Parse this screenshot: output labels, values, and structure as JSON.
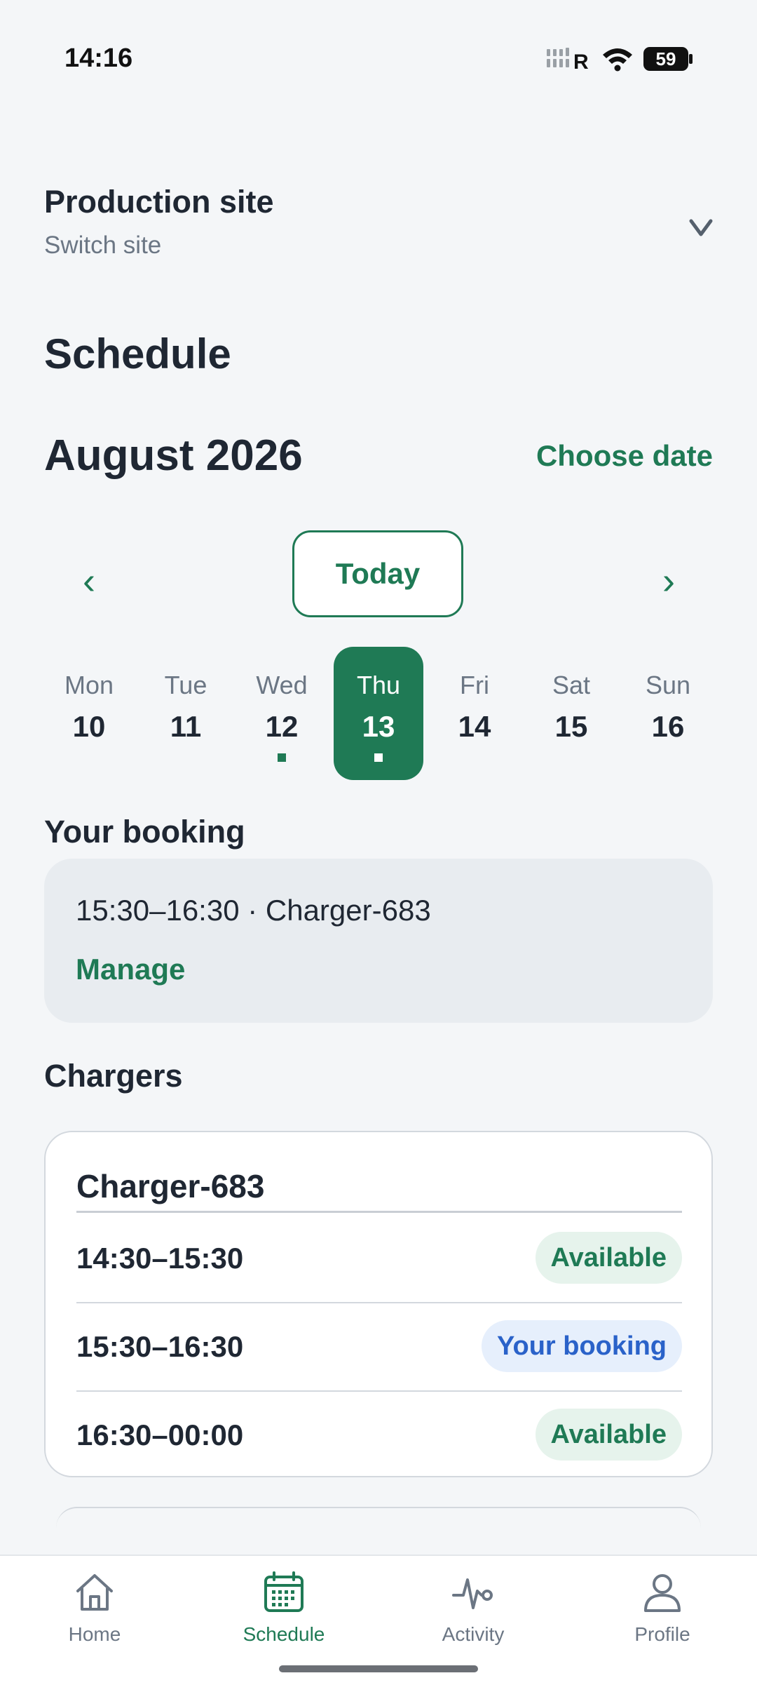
{
  "status_bar": {
    "time": "14:16",
    "battery": "59",
    "network_label": "R"
  },
  "site": {
    "name": "Production site",
    "subtitle": "Switch site"
  },
  "page_title": "Schedule",
  "calendar": {
    "month": "August 2026",
    "choose_date_label": "Choose date",
    "today_label": "Today",
    "prev_label": "‹",
    "next_label": "›",
    "days": [
      {
        "dow": "Mon",
        "dom": "10",
        "has_dot": false,
        "selected": false
      },
      {
        "dow": "Tue",
        "dom": "11",
        "has_dot": false,
        "selected": false
      },
      {
        "dow": "Wed",
        "dom": "12",
        "has_dot": true,
        "selected": false
      },
      {
        "dow": "Thu",
        "dom": "13",
        "has_dot": true,
        "selected": true
      },
      {
        "dow": "Fri",
        "dom": "14",
        "has_dot": false,
        "selected": false
      },
      {
        "dow": "Sat",
        "dom": "15",
        "has_dot": false,
        "selected": false
      },
      {
        "dow": "Sun",
        "dom": "16",
        "has_dot": false,
        "selected": false
      }
    ]
  },
  "your_booking": {
    "heading": "Your booking",
    "details": "15:30–16:30 · Charger-683",
    "manage_label": "Manage"
  },
  "chargers": {
    "heading": "Chargers",
    "items": [
      {
        "name": "Charger-683",
        "slots": [
          {
            "time": "14:30–15:30",
            "status": "Available",
            "kind": "available"
          },
          {
            "time": "15:30–16:30",
            "status": "Your booking",
            "kind": "booking"
          },
          {
            "time": "16:30–00:00",
            "status": "Available",
            "kind": "available"
          }
        ]
      }
    ]
  },
  "bottom_nav": {
    "items": [
      {
        "label": "Home",
        "icon": "home-icon",
        "active": false
      },
      {
        "label": "Schedule",
        "icon": "calendar-icon",
        "active": true
      },
      {
        "label": "Activity",
        "icon": "activity-icon",
        "active": false
      },
      {
        "label": "Profile",
        "icon": "profile-icon",
        "active": false
      }
    ]
  },
  "colors": {
    "accent": "#1f7a55",
    "background": "#f4f6f8",
    "booking_badge_text": "#2a62c9",
    "booking_badge_bg": "#e6effc",
    "available_badge_bg": "#e6f3ec"
  }
}
